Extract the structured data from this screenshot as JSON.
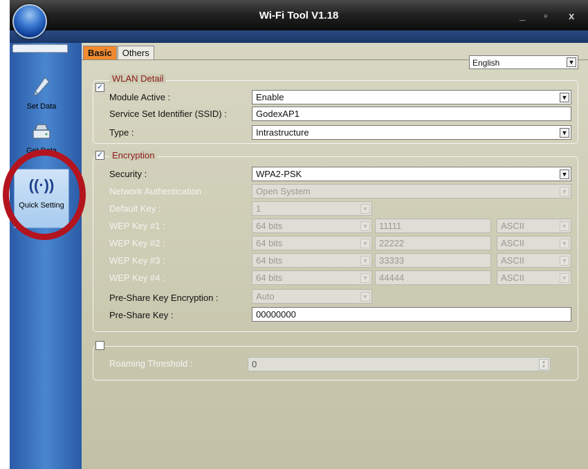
{
  "window": {
    "title": "Wi-Fi Tool V1.18",
    "buttons": {
      "minimize": "_",
      "maximize": "▫",
      "close": "x"
    }
  },
  "sidebar": {
    "items": [
      {
        "label": "Set Data",
        "icon": "pen-icon"
      },
      {
        "label": "Get Data",
        "icon": "drive-icon"
      },
      {
        "label": "Quick Setting",
        "icon": "wireless-icon"
      }
    ]
  },
  "tabs": [
    {
      "label": "Basic",
      "active": true
    },
    {
      "label": "Others",
      "active": false
    }
  ],
  "language": {
    "value": "English"
  },
  "wlan": {
    "legend": "WLAN Detail",
    "checked": true,
    "module_active": {
      "label": "Module Active :",
      "value": "Enable"
    },
    "ssid": {
      "label": "Service Set Identifier (SSID) :",
      "value": "GodexAP1"
    },
    "type": {
      "label": "Type :",
      "value": "Intrastructure"
    }
  },
  "encryption": {
    "legend": "Encryption",
    "checked": true,
    "security": {
      "label": "Security :",
      "value": "WPA2-PSK"
    },
    "network_auth": {
      "label": "Network Authentication :",
      "value": "Open System"
    },
    "default_key": {
      "label": "Default Key :",
      "value": "1"
    },
    "wep_keys": [
      {
        "label": "WEP Key #1 :",
        "bits": "64 bits",
        "key": "11111",
        "format": "ASCII"
      },
      {
        "label": "WEP Key #2 :",
        "bits": "64 bits",
        "key": "22222",
        "format": "ASCII"
      },
      {
        "label": "WEP Key #3 :",
        "bits": "64 bits",
        "key": "33333",
        "format": "ASCII"
      },
      {
        "label": "WEP Key #4 :",
        "bits": "64 bits",
        "key": "44444",
        "format": "ASCII"
      }
    ],
    "psk_encryption": {
      "label": "Pre-Share Key Encryption :",
      "value": "Auto"
    },
    "psk": {
      "label": "Pre-Share Key :",
      "value": "00000000"
    }
  },
  "roaming": {
    "checked": false,
    "label": "Roaming Threshold :",
    "value": "0"
  },
  "highlight": {
    "color": "#b4141e",
    "target": "Quick Setting"
  }
}
